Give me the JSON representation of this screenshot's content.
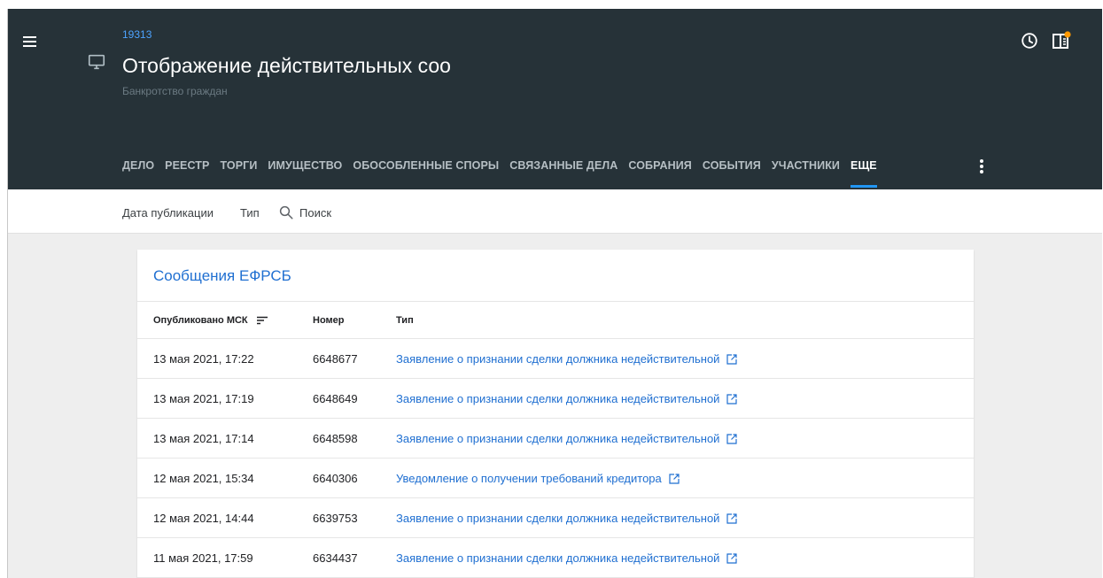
{
  "header": {
    "case_id": "19313",
    "title": "Отображение действительных соо",
    "subtitle": "Банкротство граждан",
    "colors": {
      "background": "#263238",
      "accent": "#2196f3",
      "badge": "#ff9800"
    }
  },
  "tabs": [
    {
      "label": "ДЕЛО",
      "active": false
    },
    {
      "label": "РЕЕСТР",
      "active": false
    },
    {
      "label": "ТОРГИ",
      "active": false
    },
    {
      "label": "ИМУЩЕСТВО",
      "active": false
    },
    {
      "label": "ОБОСОБЛЕННЫЕ СПОРЫ",
      "active": false
    },
    {
      "label": "СВЯЗАННЫЕ ДЕЛА",
      "active": false
    },
    {
      "label": "СОБРАНИЯ",
      "active": false
    },
    {
      "label": "СОБЫТИЯ",
      "active": false
    },
    {
      "label": "УЧАСТНИКИ",
      "active": false
    },
    {
      "label": "ЕЩЕ",
      "active": true
    }
  ],
  "filters": {
    "date_label": "Дата публикации",
    "type_label": "Тип",
    "search_placeholder": "Поиск"
  },
  "card": {
    "title": "Сообщения ЕФРСБ",
    "columns": [
      "Опубликовано МСК",
      "Номер",
      "Тип"
    ],
    "rows": [
      {
        "date": "13 мая 2021, 17:22",
        "number": "6648677",
        "type": "Заявление о признании сделки должника недействительной"
      },
      {
        "date": "13 мая 2021, 17:19",
        "number": "6648649",
        "type": "Заявление о признании сделки должника недействительной"
      },
      {
        "date": "13 мая 2021, 17:14",
        "number": "6648598",
        "type": "Заявление о признании сделки должника недействительной"
      },
      {
        "date": "12 мая 2021, 15:34",
        "number": "6640306",
        "type": "Уведомление о получении требований кредитора"
      },
      {
        "date": "12 мая 2021, 14:44",
        "number": "6639753",
        "type": "Заявление о признании сделки должника недействительной"
      },
      {
        "date": "11 мая 2021, 17:59",
        "number": "6634437",
        "type": "Заявление о признании сделки должника недействительной"
      }
    ]
  },
  "icons": {
    "menu": "menu-icon",
    "monitor": "monitor-icon",
    "clock": "clock-icon",
    "panel": "panel-icon",
    "more": "more-vert-icon",
    "search": "search-icon",
    "sort": "sort-icon",
    "external": "external-link-icon"
  }
}
